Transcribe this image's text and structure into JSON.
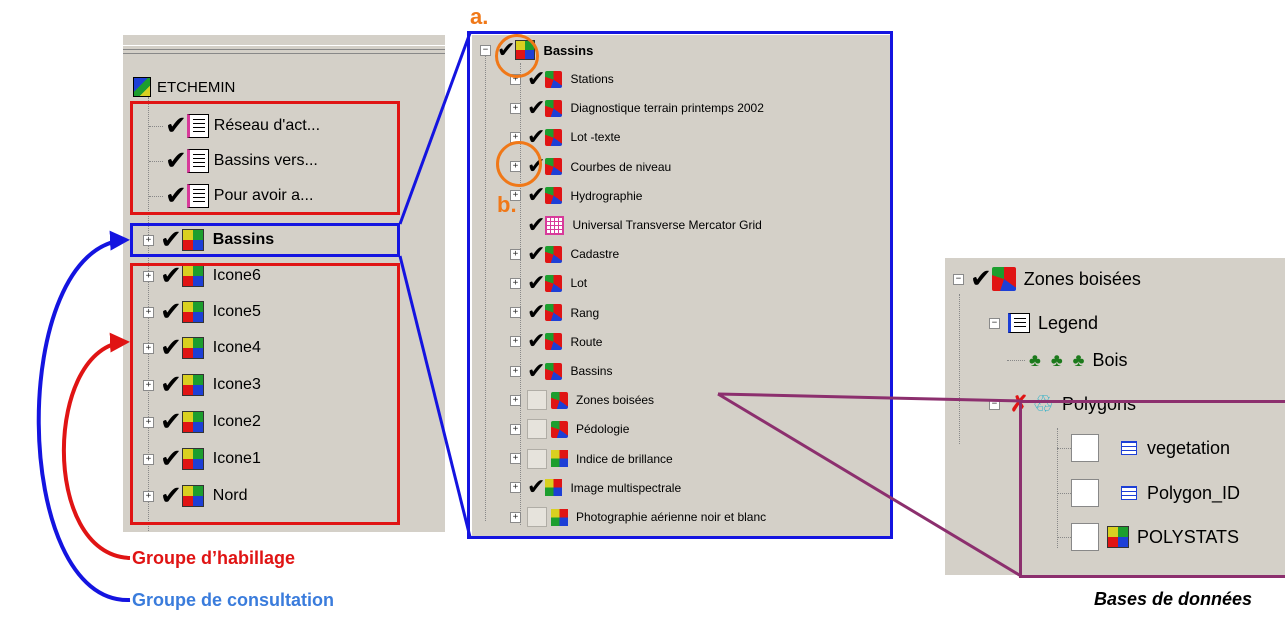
{
  "panel_left": {
    "root": "ETCHEMIN",
    "habillage_top": [
      "Réseau d'act...",
      "Bassins vers...",
      "Pour avoir a..."
    ],
    "selected": "Bassins",
    "icones": [
      "Icone6",
      "Icone5",
      "Icone4",
      "Icone3",
      "Icone2",
      "Icone1",
      "Nord"
    ]
  },
  "panel_middle": {
    "title": "Bassins",
    "layers": [
      {
        "label": "Stations",
        "checked": true
      },
      {
        "label": "Diagnostique terrain printemps 2002",
        "checked": true
      },
      {
        "label": "Lot -texte",
        "checked": true
      },
      {
        "label": "Courbes de niveau",
        "checked": true
      },
      {
        "label": "Hydrographie",
        "checked": true
      },
      {
        "label": "Universal Transverse Mercator Grid",
        "checked": true
      },
      {
        "label": "Cadastre",
        "checked": true
      },
      {
        "label": "Lot",
        "checked": true
      },
      {
        "label": "Rang",
        "checked": true
      },
      {
        "label": "Route",
        "checked": true
      },
      {
        "label": "Bassins",
        "checked": true
      },
      {
        "label": "Zones boisées",
        "checked": false
      },
      {
        "label": "Pédologie",
        "checked": false
      },
      {
        "label": "Indice de brillance",
        "checked": false
      },
      {
        "label": "Image multispectrale",
        "checked": true
      },
      {
        "label": "Photographie aérienne noir et blanc",
        "checked": false
      }
    ]
  },
  "panel_right": {
    "root": "Zones boisées",
    "legend": "Legend",
    "legend_item": "Bois",
    "polygons": "Polygons",
    "tables": [
      "vegetation",
      "Polygon_ID",
      "POLYSTATS"
    ]
  },
  "annotations": {
    "a": "a.",
    "b": "b.",
    "habillage": "Groupe d’habillage",
    "consultation": "Groupe de consultation",
    "bases": "Bases de données"
  },
  "colors": {
    "blue": "#1414e0",
    "red": "#e01414",
    "orange": "#f07818",
    "purple": "#8c2f6e",
    "blue_label": "#3a7cdc",
    "panel": "#d4d0c8"
  }
}
